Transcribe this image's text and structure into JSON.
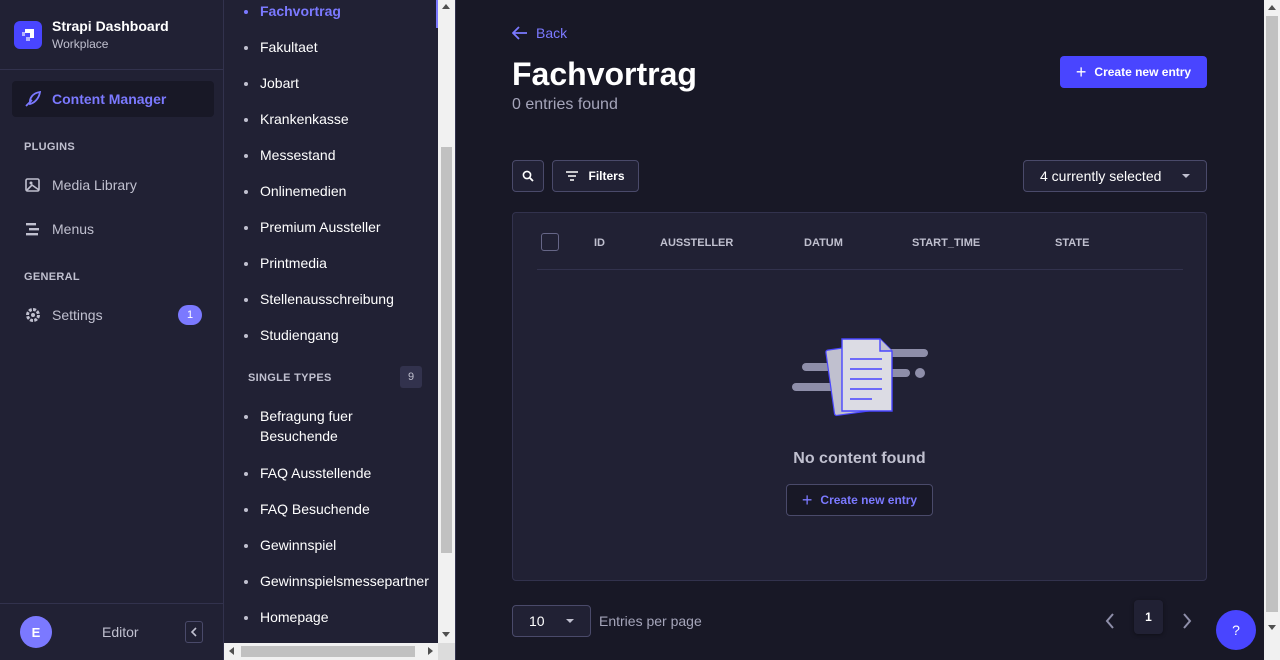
{
  "brand": {
    "title": "Strapi Dashboard",
    "subtitle": "Workplace"
  },
  "mainnav": {
    "content_manager": "Content Manager",
    "plugins_label": "PLUGINS",
    "media_library": "Media Library",
    "menus": "Menus",
    "general_label": "GENERAL",
    "settings": "Settings",
    "settings_badge": "1"
  },
  "user": {
    "initial": "E",
    "name": "Editor"
  },
  "subnav": {
    "collection_types": [
      "Fachvortrag",
      "Fakultaet",
      "Jobart",
      "Krankenkasse",
      "Messestand",
      "Onlinemedien",
      "Premium Aussteller",
      "Printmedia",
      "Stellenausschreibung",
      "Studiengang"
    ],
    "single_types_label": "SINGLE TYPES",
    "single_types_count": "9",
    "single_types": [
      "Befragung fuer Besuchende",
      "FAQ Ausstellende",
      "FAQ Besuchende",
      "Gewinnspiel",
      "Gewinnspielsmessepartner",
      "Homepage"
    ]
  },
  "main": {
    "back": "Back",
    "title": "Fachvortrag",
    "subtitle": "0 entries found",
    "create_button": "Create new entry",
    "filters": "Filters",
    "columns_select": "4 currently selected",
    "table_headers": [
      "ID",
      "AUSSTELLER",
      "DATUM",
      "START_TIME",
      "STATE"
    ],
    "empty_text": "No content found",
    "empty_create_button": "Create new entry",
    "per_page_value": "10",
    "per_page_label": "Entries per page",
    "current_page": "1",
    "help": "?"
  },
  "colors": {
    "accent": "#7b79ff",
    "primary": "#4945ff",
    "background": "#181826",
    "panel": "#212134"
  }
}
